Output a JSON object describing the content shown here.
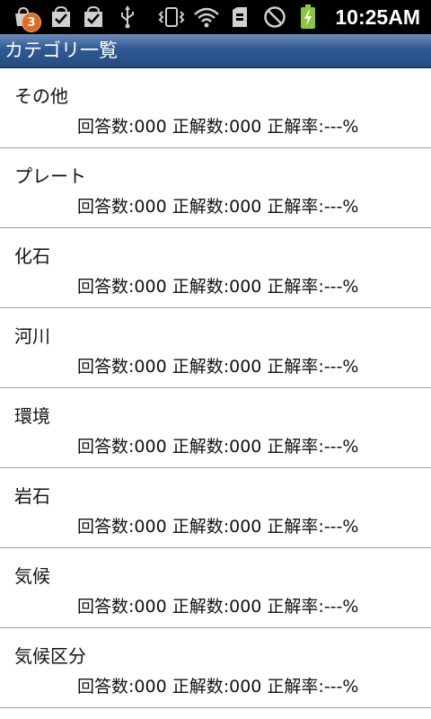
{
  "status_bar": {
    "notification_badge": "3",
    "time": "10:25AM",
    "icons": [
      "market-update-icon",
      "download-done-icon",
      "download-done-icon",
      "usb-icon",
      "vibrate-icon",
      "wifi-icon",
      "sd-card-icon",
      "no-signal-icon",
      "battery-charging-icon"
    ]
  },
  "title_bar": {
    "title": "カテゴリ一覧"
  },
  "categories": [
    {
      "name": "その他",
      "stats": "回答数:000 正解数:000 正解率:---%"
    },
    {
      "name": "プレート",
      "stats": "回答数:000 正解数:000 正解率:---%"
    },
    {
      "name": "化石",
      "stats": "回答数:000 正解数:000 正解率:---%"
    },
    {
      "name": "河川",
      "stats": "回答数:000 正解数:000 正解率:---%"
    },
    {
      "name": "環境",
      "stats": "回答数:000 正解数:000 正解率:---%"
    },
    {
      "name": "岩石",
      "stats": "回答数:000 正解数:000 正解率:---%"
    },
    {
      "name": "気候",
      "stats": "回答数:000 正解数:000 正解率:---%"
    },
    {
      "name": "気候区分",
      "stats": "回答数:000 正解数:000 正解率:---%"
    }
  ]
}
